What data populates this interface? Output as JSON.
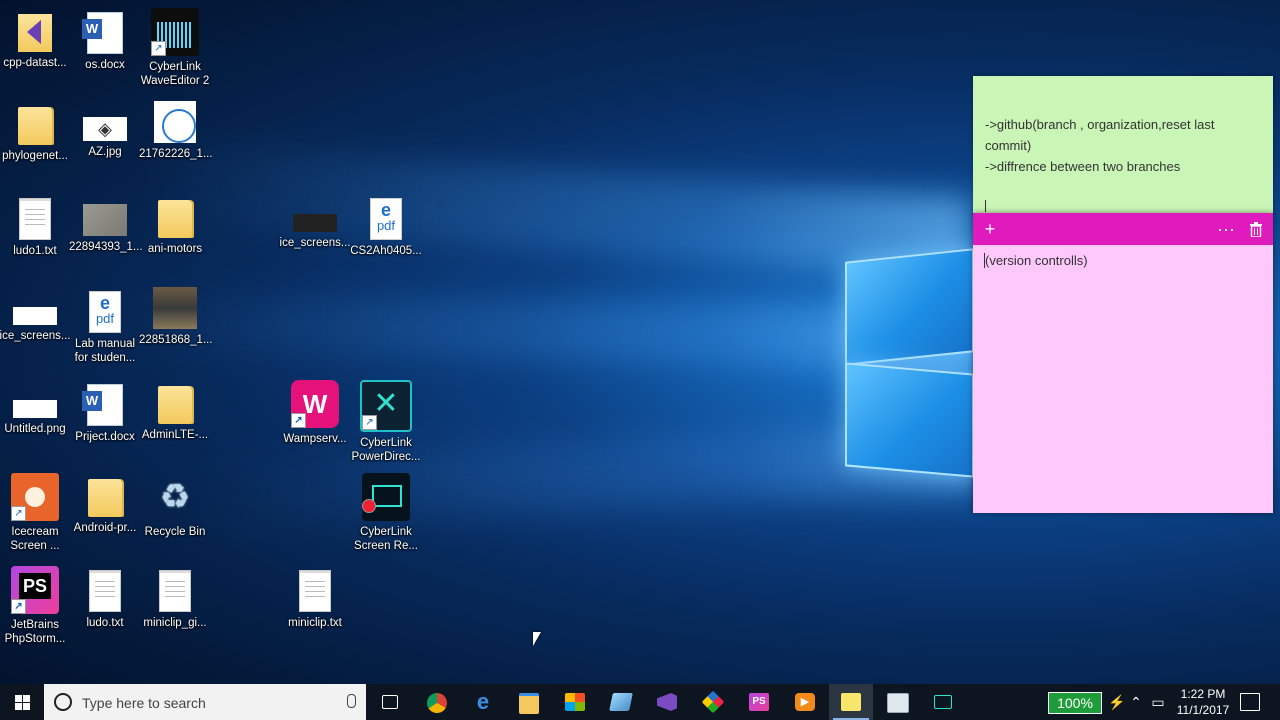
{
  "desktop_icons": [
    {
      "label": "cpp-datast...",
      "icon": "folder-vs-icon"
    },
    {
      "label": "os.docx",
      "icon": "word-doc-icon"
    },
    {
      "label": "CyberLink WaveEditor 2",
      "icon": "wave-editor-icon"
    },
    {
      "label": "phylogenet...",
      "icon": "folder-icon"
    },
    {
      "label": "AZ.jpg",
      "icon": "image-icon"
    },
    {
      "label": "21762226_1...",
      "icon": "image-icon"
    },
    {
      "label": "ludo1.txt",
      "icon": "text-file-icon"
    },
    {
      "label": "22894393_1...",
      "icon": "image-icon"
    },
    {
      "label": "ani-motors",
      "icon": "folder-icon"
    },
    {
      "label": "ice_screens...",
      "icon": "image-icon"
    },
    {
      "label": "CS2Ah0405...",
      "icon": "pdf-icon"
    },
    {
      "label": "ice_screens...",
      "icon": "image-icon"
    },
    {
      "label": "Lab manual for studen...",
      "icon": "pdf-icon"
    },
    {
      "label": "22851868_1...",
      "icon": "image-icon"
    },
    {
      "label": "Untitled.png",
      "icon": "image-icon"
    },
    {
      "label": "Priject.docx",
      "icon": "word-doc-icon"
    },
    {
      "label": "AdminLTE-...",
      "icon": "folder-icon"
    },
    {
      "label": "Wampserv...",
      "icon": "wampserver-icon"
    },
    {
      "label": "CyberLink PowerDirec...",
      "icon": "powerdirector-icon"
    },
    {
      "label": "Icecream Screen ...",
      "icon": "icecream-icon"
    },
    {
      "label": "Android-pr...",
      "icon": "folder-icon"
    },
    {
      "label": "Recycle Bin",
      "icon": "recycle-bin-icon"
    },
    {
      "label": "CyberLink Screen Re...",
      "icon": "screen-recorder-icon"
    },
    {
      "label": "JetBrains PhpStorm...",
      "icon": "phpstorm-icon"
    },
    {
      "label": "ludo.txt",
      "icon": "text-file-icon"
    },
    {
      "label": "miniclip_gi...",
      "icon": "text-file-icon"
    },
    {
      "label": "miniclip.txt",
      "icon": "text-file-icon"
    }
  ],
  "sticky_green": {
    "lines": [
      "->github(branch , organization,reset last commit)",
      "->diffrence between two branches"
    ],
    "color": "#c9f5b6"
  },
  "sticky_pink": {
    "add_glyph": "+",
    "more_glyph": "···",
    "delete_icon": "trash-icon",
    "text": "(version controlls)",
    "bar_color": "#e01bbd",
    "color": "#ffc8fb"
  },
  "taskbar": {
    "search_placeholder": "Type here to search",
    "apps": [
      "task-view-icon",
      "chrome-icon",
      "edge-icon",
      "file-explorer-icon",
      "store-icon",
      "notepad-icon",
      "visual-studio-icon",
      "git-icon",
      "phpstorm-icon",
      "media-player-icon",
      "sticky-notes-icon",
      "explorer-window-icon",
      "screen-recorder-icon"
    ],
    "active_app": "sticky-notes-icon",
    "battery": "100%",
    "time": "1:22 PM",
    "date": "11/1/2017"
  }
}
